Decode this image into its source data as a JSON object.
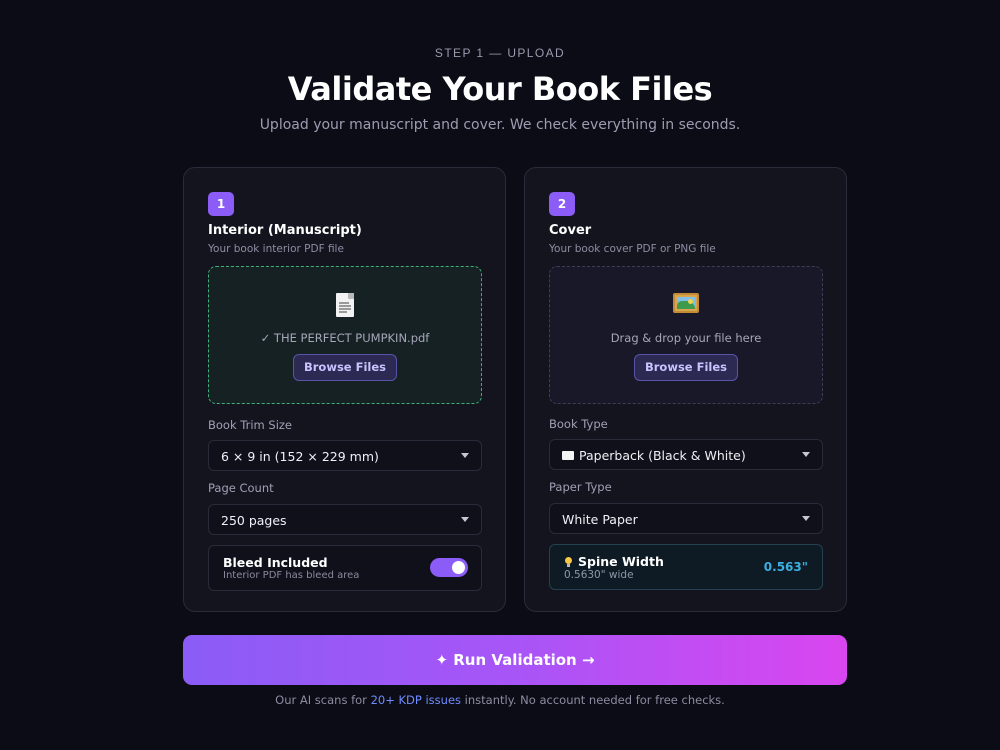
{
  "header": {
    "step_label": "STEP 1 — UPLOAD",
    "title": "Validate Your Book Files",
    "subtitle": "Upload your manuscript and cover. We check everything in seconds."
  },
  "interior": {
    "step_number": "1",
    "title": "Interior (Manuscript)",
    "description": "Your book interior PDF file",
    "dropzone": {
      "icon": "document-icon",
      "status": "success",
      "file_name": "✓ THE PERFECT PUMPKIN.pdf",
      "browse_label": "Browse Files"
    },
    "trim_size": {
      "label": "Book Trim Size",
      "value": "6 × 9 in (152 × 229 mm)"
    },
    "page_count": {
      "label": "Page Count",
      "value": "250 pages"
    },
    "bleed": {
      "title": "Bleed Included",
      "subtitle": "Interior PDF has bleed area",
      "enabled": true
    }
  },
  "cover": {
    "step_number": "2",
    "title": "Cover",
    "description": "Your book cover PDF or PNG file",
    "dropzone": {
      "icon": "picture-icon",
      "status": "idle",
      "prompt": "Drag & drop your file here",
      "browse_label": "Browse Files"
    },
    "book_type": {
      "label": "Book Type",
      "value": "Paperback (Black & White)",
      "icon": "book-icon"
    },
    "paper_type": {
      "label": "Paper Type",
      "value": "White Paper"
    },
    "spine": {
      "title": "Spine Width",
      "subtitle": "0.5630\" wide",
      "value": "0.563\"",
      "icon": "lightbulb-icon"
    }
  },
  "run_button": {
    "label": "✦ Run Validation →"
  },
  "footnote": {
    "prefix": "Our AI scans for ",
    "highlight": "20+ KDP issues",
    "suffix": " instantly. No account needed for free checks."
  },
  "colors": {
    "background": "#0c0c16",
    "accent": "#8b5cf6",
    "accent_pink": "#d946ef",
    "success": "#3fae7a",
    "spine_value": "#3bb0e0",
    "link": "#6f8cff"
  }
}
